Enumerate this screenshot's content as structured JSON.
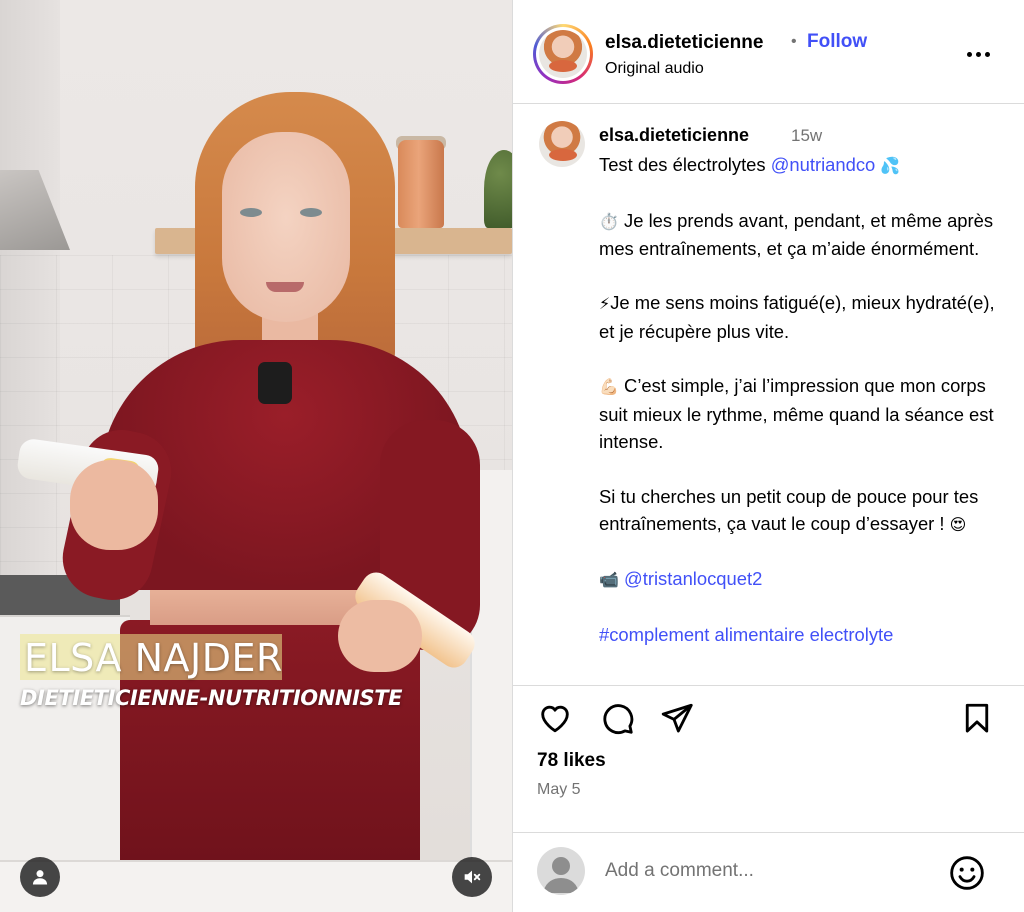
{
  "media": {
    "overlay_name": "ELSA NAJDER",
    "overlay_role": "DIETIETICIENNE-NUTRITIONNISTE",
    "user_tag_icon": "person-icon",
    "mute_icon": "speaker-muted-icon"
  },
  "header": {
    "username": "elsa.dieteticienne",
    "separator": "•",
    "follow_label": "Follow",
    "audio_label": "Original audio",
    "more_icon": "more-horizontal-icon"
  },
  "caption": {
    "username": "elsa.dieteticienne",
    "time": "15w",
    "line1_text": "Test des électrolytes ",
    "line1_mention": "@nutriandco",
    "line1_emoji": "💦",
    "para2_emoji": "⏱️",
    "para2_text": " Je les prends avant, pendant, et même après mes entraînements, et ça m’aide énormément.",
    "para3_emoji": "⚡",
    "para3_text": "Je me sens moins fatigué(e), mieux hydraté(e), et je récupère plus vite.",
    "para4_emoji": "💪🏻",
    "para4_text": " C’est simple, j’ai l’impression que mon corps suit mieux le rythme, même quand la séance est intense.",
    "para5_text": "Si tu cherches un petit coup de pouce pour tes entraînements, ça vaut le coup d’essayer ! ",
    "para5_emoji": "😍",
    "para6_emoji": "📹",
    "para6_mention": "@tristanlocquet2",
    "hashtags_partial": "#complement alimentaire electrolyte"
  },
  "actions": {
    "like_icon": "heart-icon",
    "comment_icon": "comment-bubble-icon",
    "share_icon": "paper-plane-icon",
    "save_icon": "bookmark-icon",
    "likes_text": "78 likes",
    "date_text": "May 5"
  },
  "comment": {
    "placeholder": "Add a comment...",
    "emoji_icon": "smiley-icon"
  },
  "colors": {
    "link_blue": "#4150f7",
    "muted_gray": "#737373",
    "divider": "#dbdbdb"
  }
}
